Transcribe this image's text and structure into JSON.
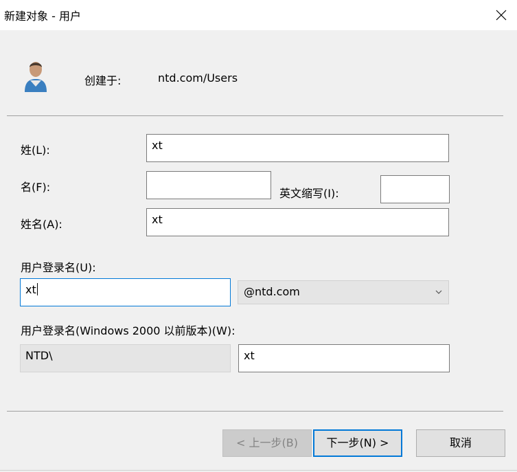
{
  "window": {
    "title": "新建对象 - 用户"
  },
  "header": {
    "created_in_label": "创建于:",
    "created_in_value": "ntd.com/Users"
  },
  "form": {
    "last_name": {
      "label": "姓(L):",
      "value": "xt"
    },
    "first_name": {
      "label": "名(F):",
      "value": ""
    },
    "initials": {
      "label": "英文缩写(I):",
      "value": ""
    },
    "full_name": {
      "label": "姓名(A):",
      "value": "xt"
    },
    "logon_name": {
      "label": "用户登录名(U):",
      "value": "xt",
      "domain_selected": "@ntd.com"
    },
    "pre2000": {
      "label": "用户登录名(Windows 2000 以前版本)(W):",
      "domain": "NTD\\",
      "value": "xt"
    }
  },
  "buttons": {
    "back": "< 上一步(B)",
    "next": "下一步(N) >",
    "cancel": "取消"
  },
  "icons": {
    "close": "close-icon",
    "user": "user-icon",
    "dropdown": "chevron-down-icon"
  },
  "colors": {
    "focus": "#0078d7",
    "background": "#f0f0f0"
  }
}
